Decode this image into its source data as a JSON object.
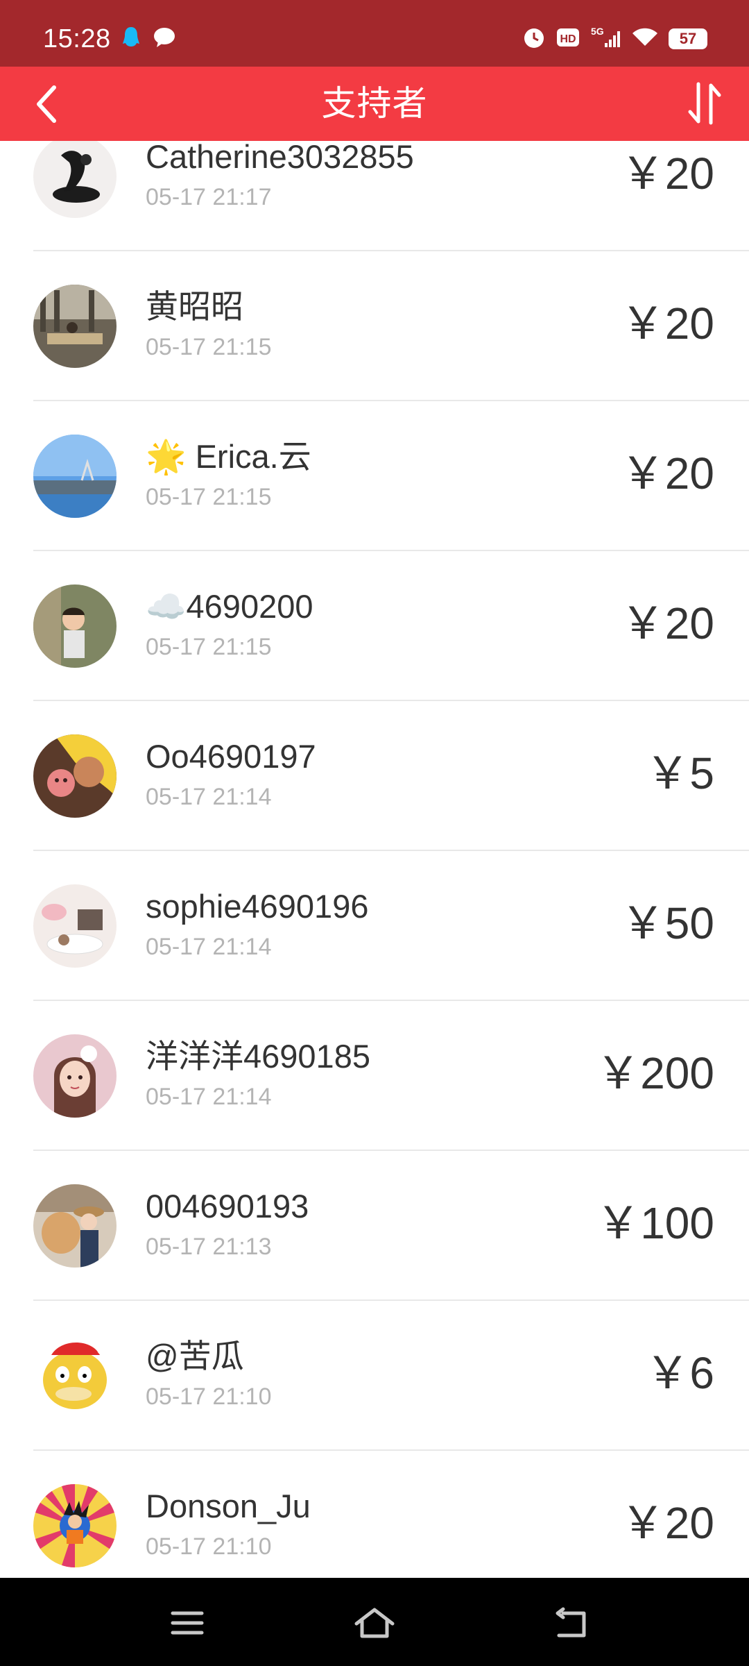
{
  "status_bar": {
    "time": "15:28",
    "battery": "57",
    "network": "5G",
    "hd": "HD"
  },
  "header": {
    "title": "支持者"
  },
  "supporters": [
    {
      "name": "Catherine3032855",
      "time": "05-17 21:17",
      "amount": "￥20"
    },
    {
      "name": "黄昭昭",
      "time": "05-17 21:15",
      "amount": "￥20"
    },
    {
      "name": "🌟 Erica.云",
      "time": "05-17 21:15",
      "amount": "￥20"
    },
    {
      "name": "☁️4690200",
      "time": "05-17 21:15",
      "amount": "￥20"
    },
    {
      "name": "Oo4690197",
      "time": "05-17 21:14",
      "amount": "￥5"
    },
    {
      "name": "sophie4690196",
      "time": "05-17 21:14",
      "amount": "￥50"
    },
    {
      "name": "洋洋洋4690185",
      "time": "05-17 21:14",
      "amount": "￥200"
    },
    {
      "name": "004690193",
      "time": "05-17 21:13",
      "amount": "￥100"
    },
    {
      "name": "@苦瓜",
      "time": "05-17 21:10",
      "amount": "￥6"
    },
    {
      "name": "Donson_Ju",
      "time": "05-17 21:10",
      "amount": "￥20"
    }
  ],
  "colors": {
    "status_bar": "#a3282c",
    "header": "#f33b43",
    "text_primary": "#333333",
    "text_secondary": "#b4b4b4",
    "divider": "#e8e8e8"
  },
  "icons": {
    "back": "chevron-left-icon",
    "sort": "sort-arrows-icon",
    "nav_menu": "menu-icon",
    "nav_home": "home-icon",
    "nav_back": "back-icon"
  }
}
